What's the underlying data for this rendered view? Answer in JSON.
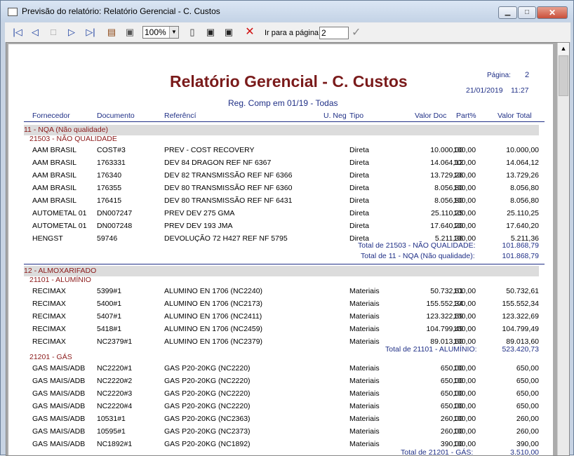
{
  "window": {
    "title": "Previsão do relatório: Relatório Gerencial - C. Custos"
  },
  "toolbar": {
    "zoom": "100%",
    "goto_label": "Ir para a página",
    "goto_value": "2"
  },
  "report": {
    "title": "Relatório Gerencial - C. Custos",
    "subtitle": "Reg. Comp em 01/19 - Todas",
    "page_label": "Página:",
    "page_number": "2",
    "date": "21/01/2019",
    "time": "11:27",
    "headers": [
      "Fornecedor",
      "Documento",
      "Referêncí",
      "U. Neg",
      "Tipo",
      "Valor Doc",
      "Part%",
      "Valor Total"
    ],
    "group1": {
      "label": "11 - NQA (Não qualidade)",
      "sub": {
        "label": "21503 - NÃO QUALIDADE",
        "rows": [
          [
            "AAM BRASIL",
            "COST#3",
            "PREV - COST RECOVERY",
            "Direta",
            "10.000,00",
            "100,00",
            "10.000,00"
          ],
          [
            "AAM BRASIL",
            "1763331",
            "DEV 84 DRAGON REF NF 6367",
            "Direta",
            "14.064,12",
            "100,00",
            "14.064,12"
          ],
          [
            "AAM BRASIL",
            "176340",
            "DEV 82 TRANSMISSÃO REF NF 6366",
            "Direta",
            "13.729,26",
            "100,00",
            "13.729,26"
          ],
          [
            "AAM BRASIL",
            "176355",
            "DEV 80 TRANSMISSÃO REF NF 6360",
            "Direta",
            "8.056,80",
            "100,00",
            "8.056,80"
          ],
          [
            "AAM BRASIL",
            "176415",
            "DEV 80 TRANSMISSÃO REF NF 6431",
            "Direta",
            "8.056,80",
            "100,00",
            "8.056,80"
          ],
          [
            "AUTOMETAL 01",
            "DN007247",
            "PREV DEV 275 GMA",
            "Direta",
            "25.110,25",
            "100,00",
            "25.110,25"
          ],
          [
            "AUTOMETAL 01",
            "DN007248",
            "PREV DEV 193 JMA",
            "Direta",
            "17.640,20",
            "100,00",
            "17.640,20"
          ],
          [
            "HENGST",
            "59746",
            "DEVOLUÇÃO 72 H427 REF NF 5795",
            "Direta",
            "5.211,36",
            "100,00",
            "5.211,36"
          ]
        ],
        "total_label": "Total de 21503 - NÃO QUALIDADE:",
        "total_value": "101.868,79"
      },
      "total_label": "Total de 11 - NQA (Não qualidade):",
      "total_value": "101.868,79"
    },
    "group2": {
      "label": "12 - ALMOXARIFADO",
      "sub1": {
        "label": "21101 - ALUMÍNIO",
        "rows": [
          [
            "RECIMAX",
            "5399#1",
            "ALUMINO  EN 1706 (NC2240)",
            "Materiais",
            "50.732,61",
            "100,00",
            "50.732,61"
          ],
          [
            "RECIMAX",
            "5400#1",
            "ALUMINO  EN 1706 (NC2173)",
            "Materiais",
            "155.552,34",
            "100,00",
            "155.552,34"
          ],
          [
            "RECIMAX",
            "5407#1",
            "ALUMINO  EN 1706 (NC2411)",
            "Materiais",
            "123.322,69",
            "100,00",
            "123.322,69"
          ],
          [
            "RECIMAX",
            "5418#1",
            "ALUMINO  EN 1706 (NC2459)",
            "Materiais",
            "104.799,49",
            "100,00",
            "104.799,49"
          ],
          [
            "RECIMAX",
            "NC2379#1",
            "ALUMINO  EN 1706 (NC2379)",
            "Materiais",
            "89.013,60",
            "100,00",
            "89.013,60"
          ]
        ],
        "total_label": "Total de 21101 - ALUMÍNIO:",
        "total_value": "523.420,73"
      },
      "sub2": {
        "label": "21201 - GÁS",
        "rows": [
          [
            "GAS MAIS/ADB",
            "NC2220#1",
            "GAS P20-20KG (NC2220)",
            "Materiais",
            "650,00",
            "100,00",
            "650,00"
          ],
          [
            "GAS MAIS/ADB",
            "NC2220#2",
            "GAS P20-20KG (NC2220)",
            "Materiais",
            "650,00",
            "100,00",
            "650,00"
          ],
          [
            "GAS MAIS/ADB",
            "NC2220#3",
            "GAS P20-20KG (NC2220)",
            "Materiais",
            "650,00",
            "100,00",
            "650,00"
          ],
          [
            "GAS MAIS/ADB",
            "NC2220#4",
            "GAS P20-20KG (NC2220)",
            "Materiais",
            "650,00",
            "100,00",
            "650,00"
          ],
          [
            "GAS MAIS/ADB",
            "10531#1",
            "GAS P20-20KG (NC2363)",
            "Materiais",
            "260,00",
            "100,00",
            "260,00"
          ],
          [
            "GAS MAIS/ADB",
            "10595#1",
            "GAS P20-20KG (NC2373)",
            "Materiais",
            "260,00",
            "100,00",
            "260,00"
          ],
          [
            "GAS MAIS/ADB",
            "NC1892#1",
            "GAS P20-20KG (NC1892)",
            "Materiais",
            "390,00",
            "100,00",
            "390,00"
          ]
        ],
        "total_label": "Total de 21201 - GÁS:",
        "total_value": "3.510,00"
      }
    }
  }
}
